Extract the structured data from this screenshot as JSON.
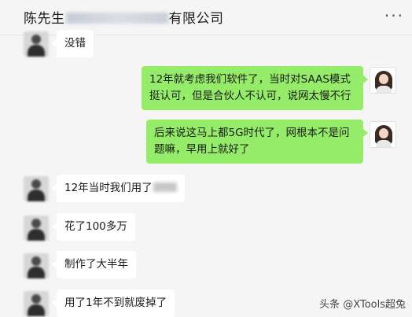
{
  "header": {
    "title_prefix": "陈先生",
    "title_suffix": "有限公司",
    "more_label": "···"
  },
  "messages": [
    {
      "side": "left",
      "text": "没错"
    },
    {
      "side": "right",
      "text": "12年就考虑我们软件了，当时对SAAS模式挺认可，但是合伙人不认可，说网太慢不行"
    },
    {
      "side": "right",
      "text": "后来说这马上都5G时代了，网根本不是问题嘛，早用上就好了"
    },
    {
      "side": "left",
      "text": "12年当时我们用了"
    },
    {
      "side": "left",
      "text": "花了100多万"
    },
    {
      "side": "left",
      "text": "制作了大半年"
    },
    {
      "side": "left",
      "text": "用了1年不到就废掉了"
    }
  ],
  "watermark": "头条 @XTools超兔"
}
